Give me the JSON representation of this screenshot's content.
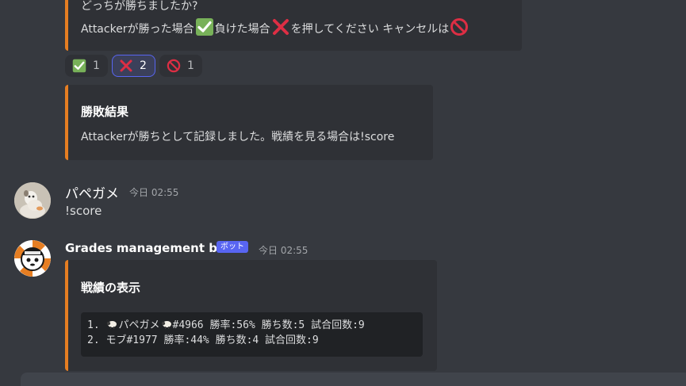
{
  "embed_top": {
    "line1": "どっちが勝ちましたか?",
    "line2_part1": "Attackerが勝った場合",
    "line2_part2": "負けた場合",
    "line2_part3": "を押してください キャンセルは"
  },
  "reactions": [
    {
      "emoji": "check-mark",
      "count": "1",
      "active": false
    },
    {
      "emoji": "cross-mark",
      "count": "2",
      "active": true
    },
    {
      "emoji": "no-entry",
      "count": "1",
      "active": false
    }
  ],
  "embed_result": {
    "title": "勝敗結果",
    "description": "Attackerが勝ちとして記録しました。戦績を見る場合は!score"
  },
  "message_user": {
    "username": "パペガメ",
    "timestamp": "今日 02:55",
    "content": "!score"
  },
  "message_bot": {
    "username": "Grades management bot",
    "tag": "ボット",
    "timestamp": "今日 02:55"
  },
  "embed_stats": {
    "title": "戦績の表示",
    "line1_prefix": "1. ",
    "line1_name": "パペガメ",
    "line1_rest": "#4966 勝率:56% 勝ち数:5 試合回数:9",
    "line2": "2. モブ#1977 勝率:44% 勝ち数:4 試合回数:9"
  },
  "colors": {
    "background": "#36393f",
    "embed_bg": "#2f3136",
    "embed_accent": "#e67e22",
    "bot_tag": "#5865f2",
    "reaction_active_border": "#5865f2"
  }
}
